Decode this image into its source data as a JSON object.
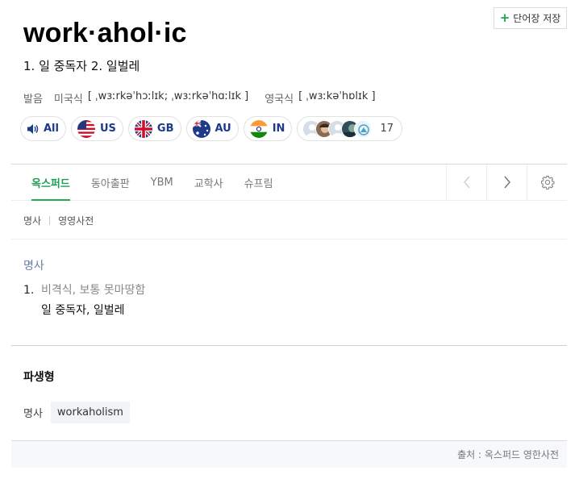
{
  "header": {
    "save_label": "단어장 저장",
    "headword": "work·ahol·ic",
    "summary": "1. 일 중독자 2. 일벌레"
  },
  "pronunciation": {
    "label": "발음",
    "us_label": "미국식",
    "us_value": "[ ˌwɜːrkəˈhɔːlɪk; ˌwɜːrkəˈhɑːlɪk ]",
    "uk_label": "영국식",
    "uk_value": "[ ˌwɜːkəˈhɒlɪk ]"
  },
  "audio": {
    "all": "All",
    "us": "US",
    "gb": "GB",
    "au": "AU",
    "in": "IN",
    "user_count": "17"
  },
  "tabs": [
    "옥스퍼드",
    "동아출판",
    "YBM",
    "교학사",
    "슈프림"
  ],
  "subnav": [
    "명사",
    "영영사전"
  ],
  "entry": {
    "pos": "명사",
    "sense_number": "1.",
    "sense_note": "비격식, 보통 못마땅함",
    "sense_gloss": "일 중독자, 일벌레"
  },
  "derivative": {
    "title": "파생형",
    "pos": "명사",
    "word": "workaholism"
  },
  "source": "출처 : 옥스퍼드 영한사전",
  "colors": {
    "accent_green": "#1f9d52",
    "pos_blue": "#6a7fa8",
    "pill_text": "#1b3a8a"
  }
}
